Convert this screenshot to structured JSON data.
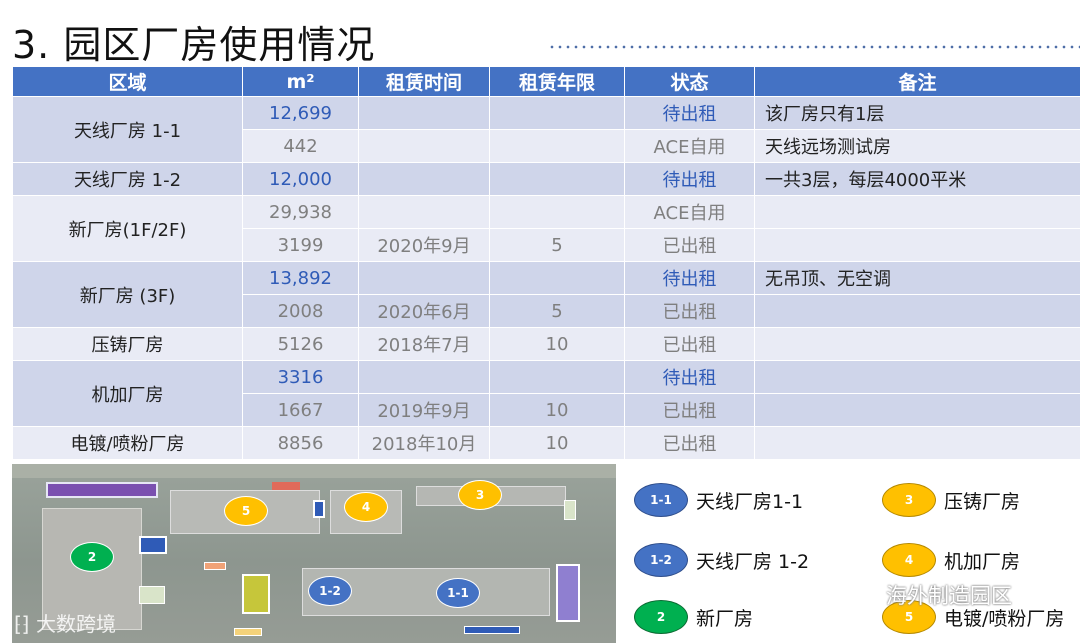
{
  "title": "3. 园区厂房使用情况",
  "table": {
    "headers": [
      "区域",
      "m²",
      "租赁时间",
      "租赁年限",
      "状态",
      "备注"
    ],
    "rows": [
      {
        "area": "天线厂房 1-1",
        "size": "12,699",
        "time": "",
        "years": "",
        "status": "待出租",
        "note": "该厂房只有1层"
      },
      {
        "size": "442",
        "time": "",
        "years": "",
        "status": "ACE自用",
        "note": "天线远场测试房"
      },
      {
        "area": "天线厂房 1-2",
        "size": "12,000",
        "time": "",
        "years": "",
        "status": "待出租",
        "note": "一共3层，每层4000平米"
      },
      {
        "area": "新厂房(1F/2F)",
        "size": "29,938",
        "time": "",
        "years": "",
        "status": "ACE自用",
        "note": ""
      },
      {
        "size": "3199",
        "time": "2020年9月",
        "years": "5",
        "status": "已出租",
        "note": ""
      },
      {
        "area": "新厂房 (3F)",
        "size": "13,892",
        "time": "",
        "years": "",
        "status": "待出租",
        "note": "无吊顶、无空调"
      },
      {
        "size": "2008",
        "time": "2020年6月",
        "years": "5",
        "status": "已出租",
        "note": ""
      },
      {
        "area": "压铸厂房",
        "size": "5126",
        "time": "2018年7月",
        "years": "10",
        "status": "已出租",
        "note": ""
      },
      {
        "area": "机加厂房",
        "size": "3316",
        "time": "",
        "years": "",
        "status": "待出租",
        "note": ""
      },
      {
        "size": "1667",
        "time": "2019年9月",
        "years": "10",
        "status": "已出租",
        "note": ""
      },
      {
        "area": "电镀/喷粉厂房",
        "size": "8856",
        "time": "2018年10月",
        "years": "10",
        "status": "已出租",
        "note": ""
      }
    ]
  },
  "map_markers": [
    "1-1",
    "1-2",
    "2",
    "3",
    "4",
    "5"
  ],
  "legend": [
    {
      "code": "1-1",
      "label": "天线厂房1-1",
      "color": "#4472c4"
    },
    {
      "code": "3",
      "label": "压铸厂房",
      "color": "#ffc000"
    },
    {
      "code": "1-2",
      "label": "天线厂房 1-2",
      "color": "#4472c4"
    },
    {
      "code": "4",
      "label": "机加厂房",
      "color": "#ffc000"
    },
    {
      "code": "2",
      "label": "新厂房",
      "color": "#00b050"
    },
    {
      "code": "5",
      "label": "电镀/喷粉厂房",
      "color": "#ffc000"
    }
  ],
  "watermark_left": "大数跨境",
  "watermark_right": "海外制造园区",
  "colors": {
    "header": "#4472c4",
    "row_a": "#cfd5ea",
    "row_b": "#e9ebf5",
    "available": "#2f5bb7"
  }
}
